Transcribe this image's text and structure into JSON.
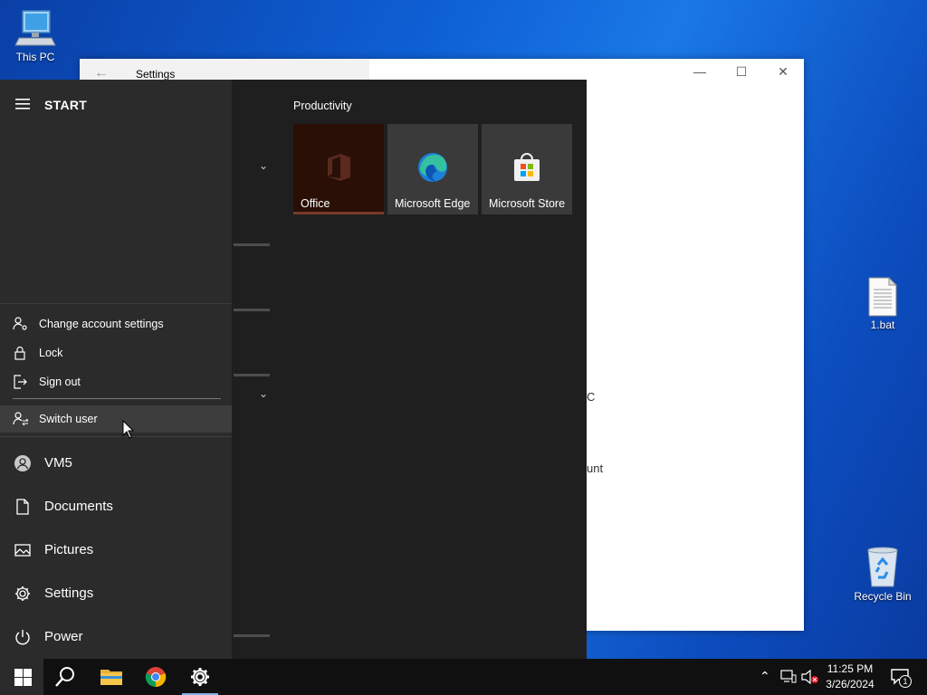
{
  "desktop": {
    "icons": [
      {
        "label": "This PC",
        "icon": "computer-icon"
      },
      {
        "label": "1.bat",
        "icon": "batch-file-icon"
      },
      {
        "label": "Recycle Bin",
        "icon": "recycle-bin-icon"
      }
    ]
  },
  "settings_window": {
    "title": "Settings",
    "peek_text_1": "C",
    "peek_text_2": "unt"
  },
  "start_menu": {
    "title": "START",
    "account_flyout": {
      "items": [
        {
          "label": "Change account settings",
          "icon": "person-gear-icon"
        },
        {
          "label": "Lock",
          "icon": "lock-icon"
        },
        {
          "label": "Sign out",
          "icon": "sign-out-icon"
        },
        {
          "label": "Switch user",
          "icon": "switch-user-icon"
        }
      ]
    },
    "rail": [
      {
        "label": "VM5",
        "icon": "user-avatar-icon"
      },
      {
        "label": "Documents",
        "icon": "document-icon"
      },
      {
        "label": "Pictures",
        "icon": "picture-icon"
      },
      {
        "label": "Settings",
        "icon": "gear-icon"
      },
      {
        "label": "Power",
        "icon": "power-icon"
      }
    ],
    "tile_group": "Productivity",
    "tiles": [
      {
        "label": "Office",
        "icon": "office-icon"
      },
      {
        "label": "Microsoft Edge",
        "icon": "edge-icon"
      },
      {
        "label": "Microsoft Store",
        "icon": "store-icon"
      }
    ]
  },
  "taskbar": {
    "clock_time": "11:25 PM",
    "clock_date": "3/26/2024",
    "notification_count": "1"
  },
  "colors": {
    "desktop_accent": "#0e5fd4",
    "start_bg": "#1f1f1f",
    "start_rail_bg": "#2b2b2b",
    "taskbar_bg": "#101010"
  }
}
